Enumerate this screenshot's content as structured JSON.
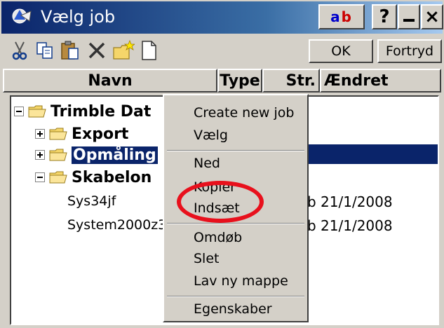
{
  "window": {
    "title": "Vælg job",
    "title_buttons": {
      "ab_a": "a",
      "ab_b": "b",
      "help": "?",
      "close": "×"
    },
    "accent_color": "#0a246a"
  },
  "toolbar": {
    "icons": [
      "cut-icon",
      "copy-icon",
      "paste-icon",
      "delete-icon",
      "new-folder-icon",
      "new-document-icon"
    ],
    "ok_label": "OK",
    "cancel_label": "Fortryd"
  },
  "columns": {
    "name": "Navn",
    "type": "Type",
    "size": "Str.",
    "modified": "Ændret"
  },
  "tree": {
    "root": {
      "label": "Trimble Dat",
      "expanded": true
    },
    "items": [
      {
        "label": "Export",
        "expanded": false
      },
      {
        "label": "Opmåling",
        "expanded": false,
        "selected": true
      },
      {
        "label": "Skabelon",
        "expanded": true
      }
    ],
    "children": [
      {
        "label": "Sys34jf",
        "date": "b 21/1/2008"
      },
      {
        "label": "System2000z3",
        "date": "b 21/1/2008"
      }
    ]
  },
  "context_menu": {
    "items": [
      {
        "label": "Create new job",
        "group": 1
      },
      {
        "label": "Vælg",
        "group": 1
      },
      {
        "label": "Ned",
        "group": 2
      },
      {
        "label": "Kopier",
        "group": 2
      },
      {
        "label": "Indsæt",
        "group": 2,
        "highlighted_by_annotation": true
      },
      {
        "label": "Omdøb",
        "group": 3
      },
      {
        "label": "Slet",
        "group": 3
      },
      {
        "label": "Lav ny mappe",
        "group": 3
      },
      {
        "label": "Egenskaber",
        "group": 4
      }
    ],
    "annotation_color": "#e8101c"
  }
}
